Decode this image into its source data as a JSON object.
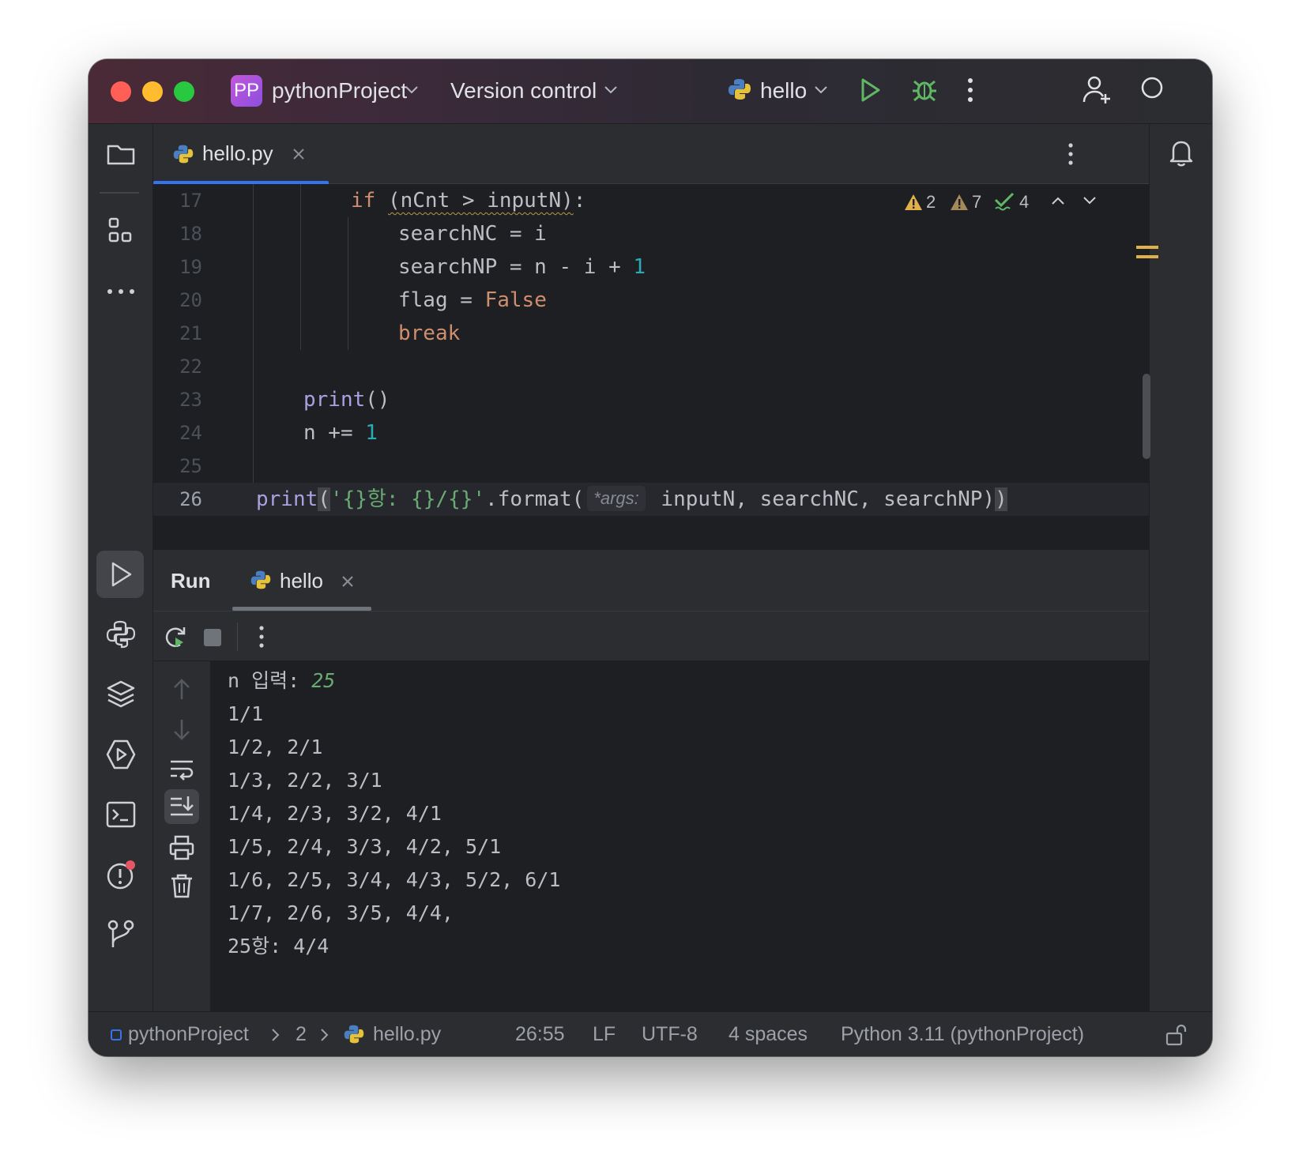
{
  "titlebar": {
    "project_badge": "PP",
    "project_name": "pythonProject",
    "version_control": "Version control",
    "run_config": "hello"
  },
  "editor": {
    "tab_label": "hello.py",
    "inspections": {
      "warnings_a": "2",
      "warnings_b": "7",
      "ok": "4"
    },
    "line_numbers": [
      "17",
      "18",
      "19",
      "20",
      "21",
      "22",
      "23",
      "24",
      "25",
      "26"
    ],
    "lines": {
      "l17_kw": "if",
      "l17_cond": "(nCnt > inputN)",
      "l17_colon": ":",
      "l18": "searchNC = i",
      "l19_text": "searchNP = n - i + ",
      "l19_num": "1",
      "l20_text": "flag = ",
      "l20_kw": "False",
      "l21_kw": "break",
      "l23_fn": "print",
      "l23_rest": "()",
      "l24_text": "n += ",
      "l24_num": "1",
      "l26_fn": "print",
      "l26_open": "(",
      "l26_str": "'{}항: {}/{}'",
      "l26_mid": ".format(",
      "l26_hint": "*args:",
      "l26_args": " inputN, searchNC, searchNP)",
      "l26_close": ")"
    }
  },
  "run_panel": {
    "run_label": "Run",
    "tab_label": "hello",
    "output": {
      "prompt": "n 입력: ",
      "input_value": "25",
      "lines": [
        "1/1",
        "1/2, 2/1",
        "1/3, 2/2, 3/1",
        "1/4, 2/3, 3/2, 4/1",
        "1/5, 2/4, 3/3, 4/2, 5/1",
        "1/6, 2/5, 3/4, 4/3, 5/2, 6/1",
        "1/7, 2/6, 3/5, 4/4,",
        "25항: 4/4"
      ]
    }
  },
  "statusbar": {
    "project": "pythonProject",
    "folder": "2",
    "file": "hello.py",
    "position": "26:55",
    "line_sep": "LF",
    "encoding": "UTF-8",
    "indent": "4 spaces",
    "interpreter": "Python 3.11 (pythonProject)"
  },
  "colors": {
    "accent": "#3574f0",
    "keyword": "#cf8e6d",
    "function": "#a9a1e1",
    "number": "#2aacb8",
    "string": "#6aab73",
    "warning": "#e0b14b",
    "run_green": "#5fb865"
  }
}
